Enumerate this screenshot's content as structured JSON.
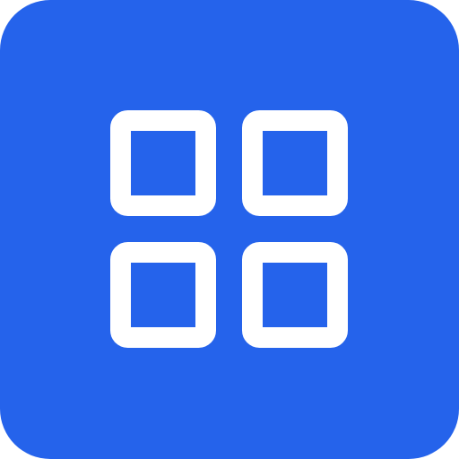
{
  "app_icon": {
    "icon": "grid-icon",
    "background_color": "#2563EB",
    "foreground_color": "#FFFFFF"
  }
}
